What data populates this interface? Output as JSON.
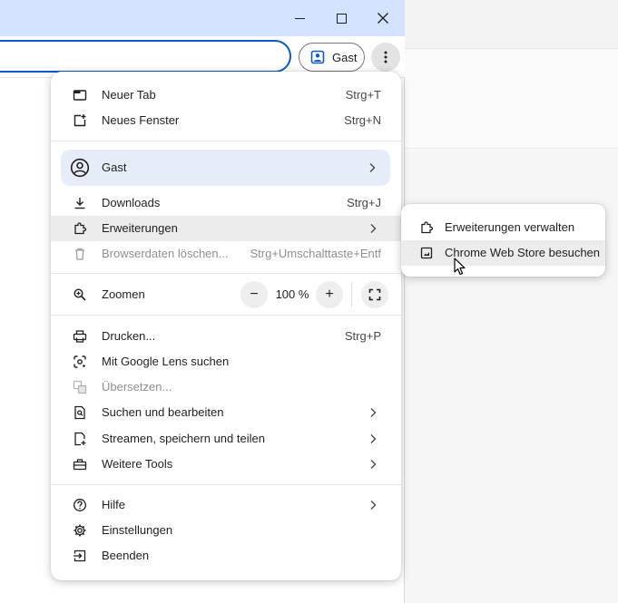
{
  "window": {
    "minimize_icon": "minimize-icon",
    "maximize_icon": "maximize-icon",
    "close_icon": "close-icon"
  },
  "toolbar": {
    "profile_label": "Gast",
    "profile_icon": "person-badge-icon",
    "menu_icon": "kebab-menu-icon",
    "accent_color": "#0b57d0"
  },
  "menu": {
    "new_tab": {
      "label": "Neuer Tab",
      "shortcut": "Strg+T",
      "icon": "new-tab-icon"
    },
    "new_window": {
      "label": "Neues Fenster",
      "shortcut": "Strg+N",
      "icon": "new-window-icon"
    },
    "profile": {
      "label": "Gast",
      "icon": "account-circle-icon"
    },
    "downloads": {
      "label": "Downloads",
      "shortcut": "Strg+J",
      "icon": "download-icon"
    },
    "extensions": {
      "label": "Erweiterungen",
      "icon": "puzzle-icon"
    },
    "clear_data": {
      "label": "Browserdaten löschen...",
      "shortcut": "Strg+Umschalttaste+Entf",
      "icon": "trash-icon"
    },
    "zoom": {
      "label": "Zoomen",
      "value": "100 %",
      "minus": "−",
      "plus": "+",
      "icon": "zoom-icon"
    },
    "print": {
      "label": "Drucken...",
      "shortcut": "Strg+P",
      "icon": "printer-icon"
    },
    "lens": {
      "label": "Mit Google Lens suchen",
      "icon": "lens-icon"
    },
    "translate": {
      "label": "Übersetzen...",
      "icon": "translate-icon"
    },
    "find_edit": {
      "label": "Suchen und bearbeiten",
      "icon": "find-page-icon"
    },
    "cast": {
      "label": "Streamen, speichern und teilen",
      "icon": "cast-save-icon"
    },
    "more_tools": {
      "label": "Weitere Tools",
      "icon": "toolbox-icon"
    },
    "help": {
      "label": "Hilfe",
      "icon": "help-icon"
    },
    "settings": {
      "label": "Einstellungen",
      "icon": "gear-icon"
    },
    "exit": {
      "label": "Beenden",
      "icon": "exit-icon"
    }
  },
  "submenu": {
    "manage": {
      "label": "Erweiterungen verwalten",
      "icon": "puzzle-icon"
    },
    "webstore": {
      "label": "Chrome Web Store besuchen",
      "icon": "webstore-icon"
    }
  }
}
